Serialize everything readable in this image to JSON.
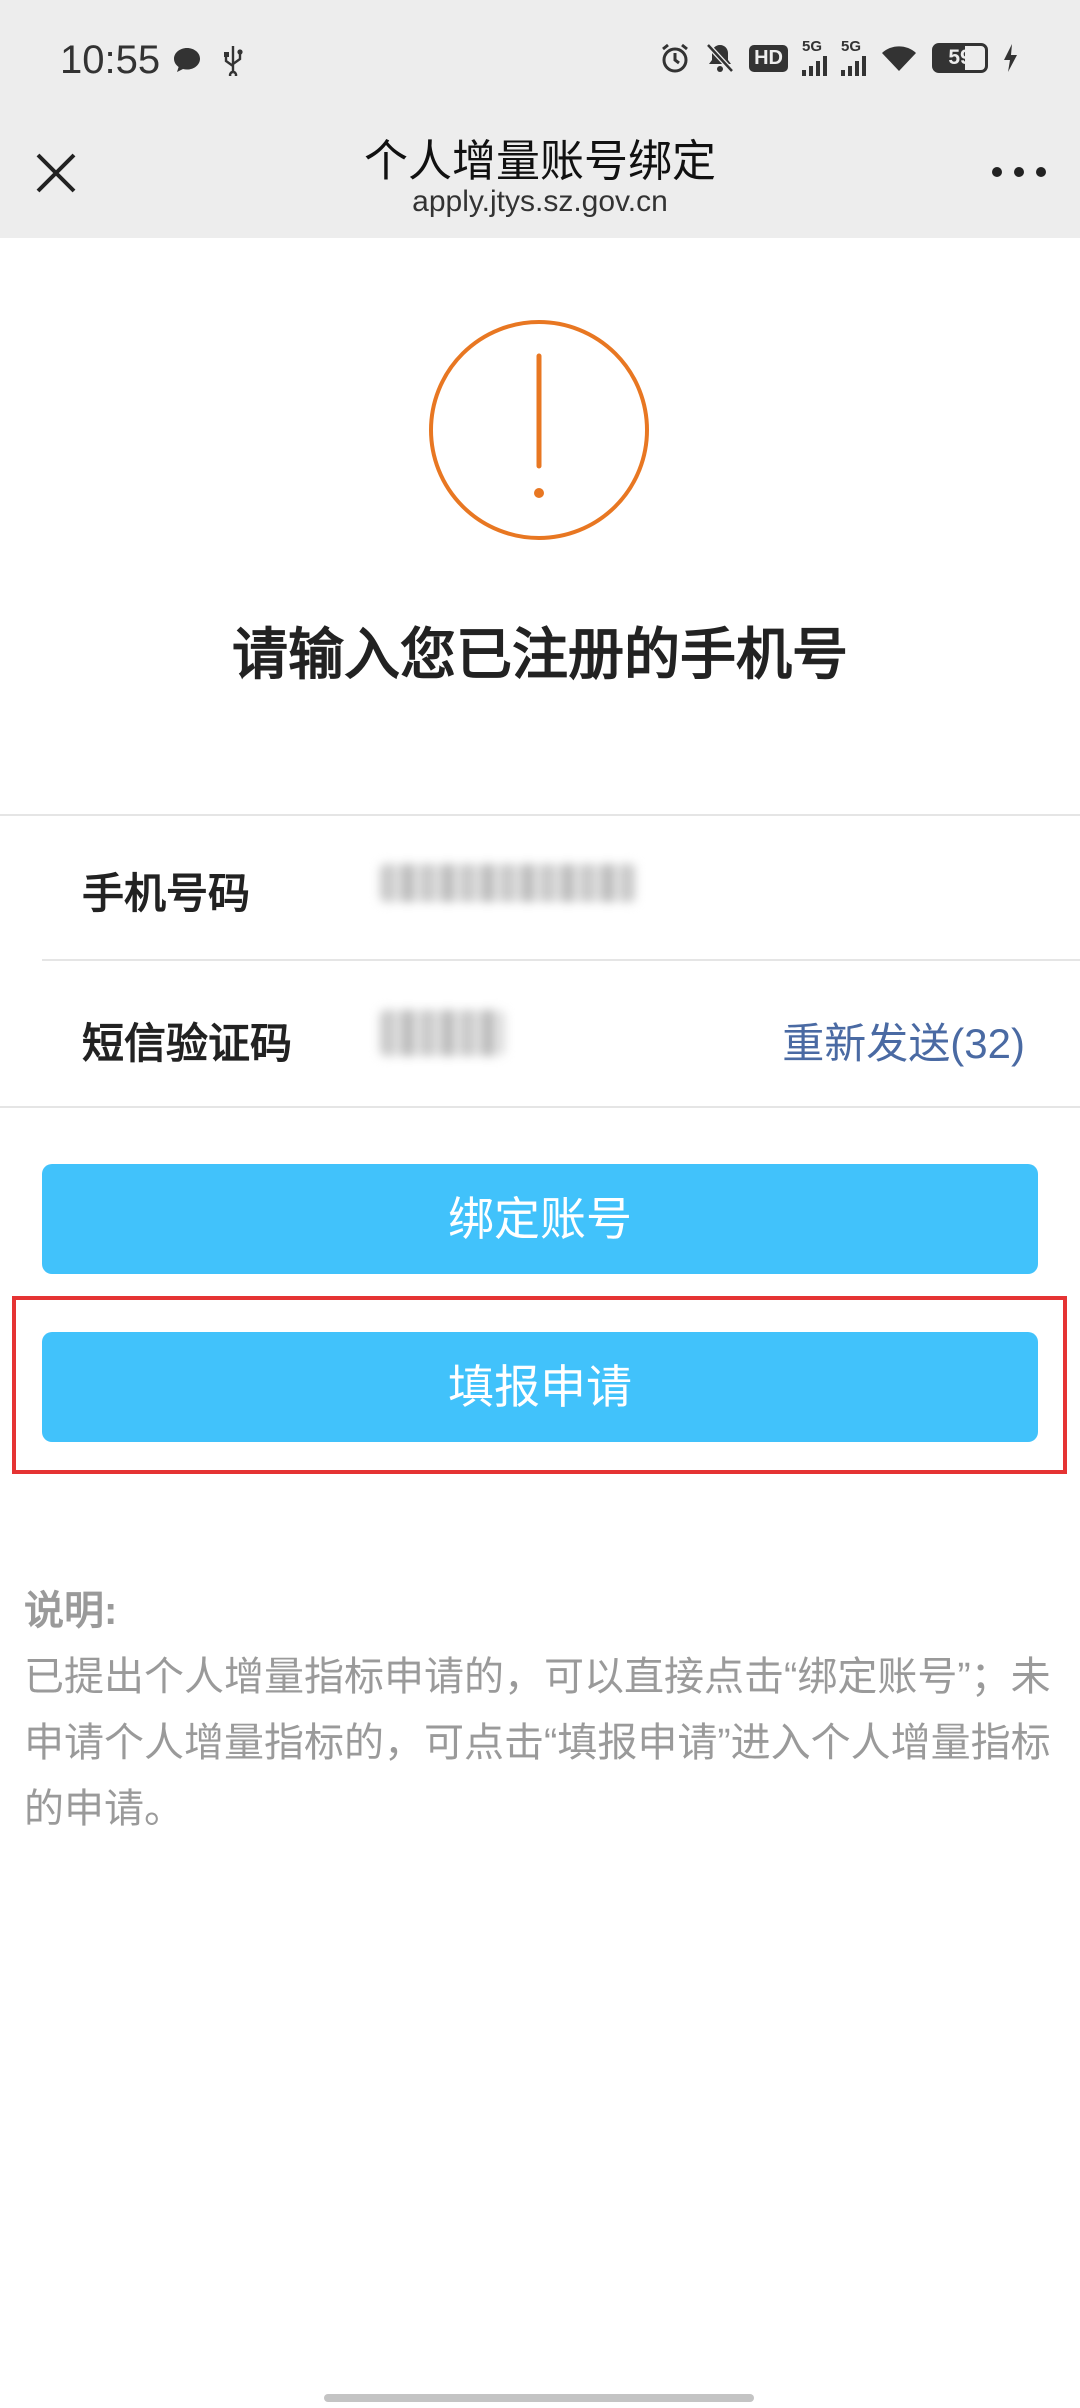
{
  "status_bar": {
    "time": "10:55",
    "left_icons": [
      "chat-bubble-icon",
      "usb-icon"
    ],
    "right_icons": [
      "alarm-icon",
      "mute-bell-icon",
      "hd-icon",
      "signal-5g-icon",
      "signal-5g-icon",
      "wifi-icon",
      "battery-icon",
      "charging-icon"
    ],
    "hd_label": "HD",
    "net_label": "5G",
    "battery": "59"
  },
  "nav": {
    "title": "个人增量账号绑定",
    "url": "apply.jtys.sz.gov.cn"
  },
  "hero": {
    "icon": "exclamation-circle-icon",
    "accent": "#e87722",
    "headline": "请输入您已注册的手机号"
  },
  "form": {
    "phone_label": "手机号码",
    "sms_label": "短信验证码",
    "resend_label": "重新发送(32)"
  },
  "buttons": {
    "bind_label": "绑定账号",
    "apply_label": "填报申请",
    "color": "#41c2fb"
  },
  "note": {
    "title": "说明:",
    "body": "已提出个人增量指标申请的，可以直接点击“绑定账号”；未申请个人增量指标的，可点击“填报申请”进入个人增量指标的申请。"
  }
}
